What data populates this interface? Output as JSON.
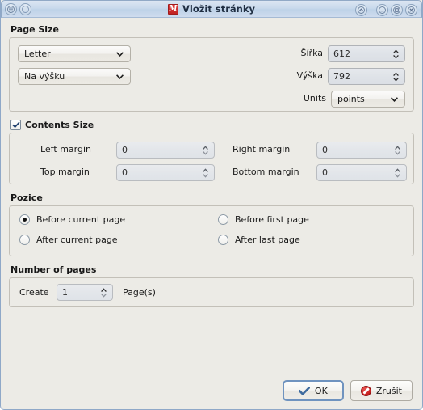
{
  "window": {
    "title": "Vložit stránky",
    "app_icon": "scribus-icon",
    "titlebar_buttons": {
      "menu": "window-menu-icon",
      "help": "help-icon",
      "shade": "shade-icon",
      "minimize": "minimize-icon",
      "maximize": "maximize-icon",
      "close": "close-icon"
    }
  },
  "page_size": {
    "title": "Page Size",
    "format_value": "Letter",
    "orientation_value": "Na výšku",
    "width_label": "Šířka",
    "width_value": "612",
    "height_label": "Výška",
    "height_value": "792",
    "units_label": "Units",
    "units_value": "points"
  },
  "contents_size": {
    "title": "Contents Size",
    "checked": true,
    "left_margin_label": "Left margin",
    "left_margin_value": "0",
    "right_margin_label": "Right margin",
    "right_margin_value": "0",
    "top_margin_label": "Top margin",
    "top_margin_value": "0",
    "bottom_margin_label": "Bottom margin",
    "bottom_margin_value": "0"
  },
  "position": {
    "title": "Pozice",
    "options": [
      {
        "label": "Before current page",
        "selected": true
      },
      {
        "label": "Before first page",
        "selected": false
      },
      {
        "label": "After current page",
        "selected": false
      },
      {
        "label": "After last page",
        "selected": false
      }
    ]
  },
  "number_of_pages": {
    "title": "Number of pages",
    "create_label": "Create",
    "count_value": "1",
    "pages_label": "Page(s)"
  },
  "footer": {
    "ok_label": "OK",
    "cancel_label": "Zrušit"
  },
  "colors": {
    "titlebar": "#c9d9ec",
    "dialog_bg": "#ecebe6",
    "accent_border": "#8fa8c8",
    "ok_check": "#3d6a9e",
    "cancel_red": "#c61f1f"
  }
}
